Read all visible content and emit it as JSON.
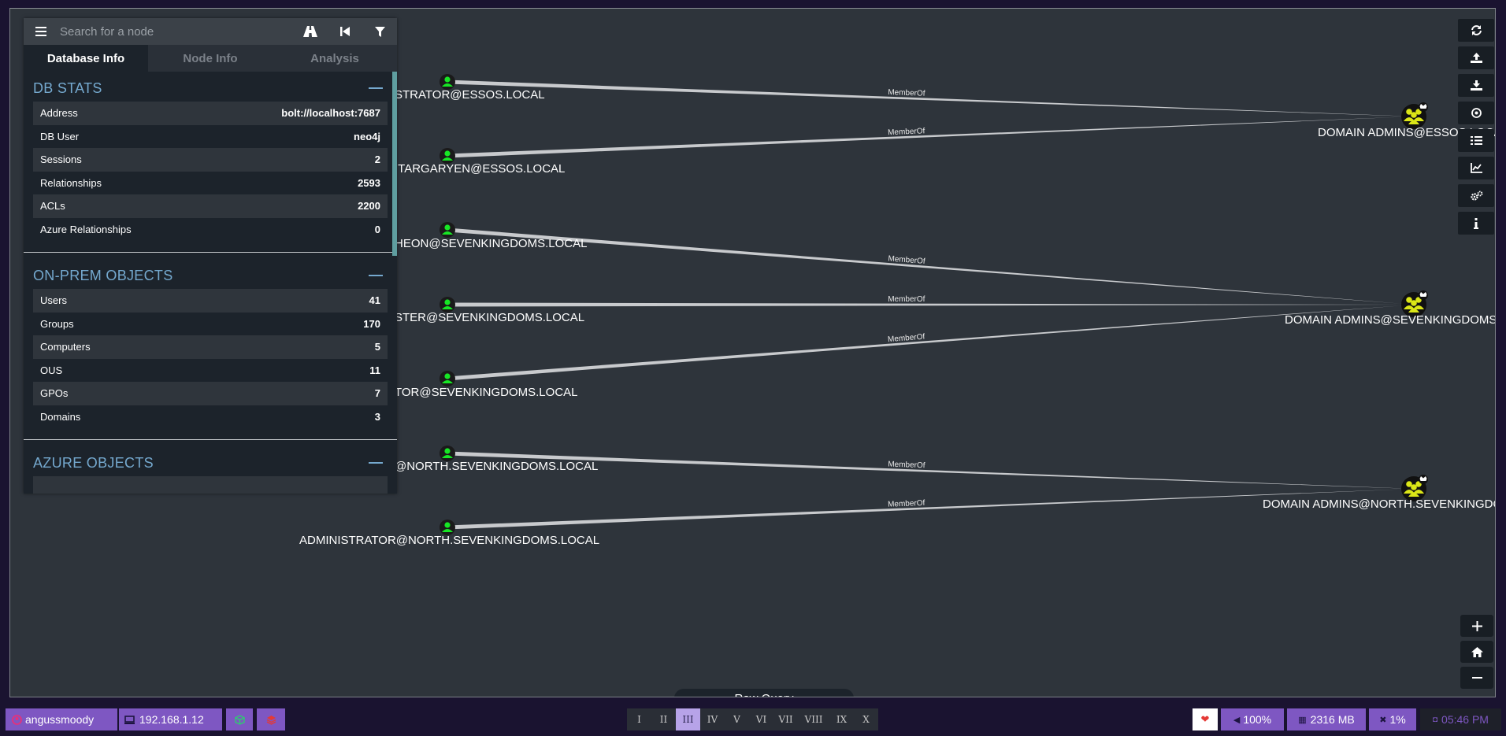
{
  "search": {
    "placeholder": "Search for a node"
  },
  "tabs": [
    {
      "label": "Database Info",
      "active": true
    },
    {
      "label": "Node Info",
      "active": false
    },
    {
      "label": "Analysis",
      "active": false
    }
  ],
  "db_stats": {
    "title": "DB STATS",
    "rows": [
      {
        "label": "Address",
        "value": "bolt://localhost:7687"
      },
      {
        "label": "DB User",
        "value": "neo4j"
      },
      {
        "label": "Sessions",
        "value": "2"
      },
      {
        "label": "Relationships",
        "value": "2593"
      },
      {
        "label": "ACLs",
        "value": "2200"
      },
      {
        "label": "Azure Relationships",
        "value": "0"
      }
    ]
  },
  "onprem": {
    "title": "ON-PREM OBJECTS",
    "rows": [
      {
        "label": "Users",
        "value": "41"
      },
      {
        "label": "Groups",
        "value": "170"
      },
      {
        "label": "Computers",
        "value": "5"
      },
      {
        "label": "OUS",
        "value": "11"
      },
      {
        "label": "GPOs",
        "value": "7"
      },
      {
        "label": "Domains",
        "value": "3"
      }
    ]
  },
  "azure": {
    "title": "AZURE OBJECTS"
  },
  "graph": {
    "users": [
      {
        "label": "STRATOR@ESSOS.LOCAL"
      },
      {
        "label": ".TARGARYEN@ESSOS.LOCAL"
      },
      {
        "label": "HEON@SEVENKINGDOMS.LOCAL"
      },
      {
        "label": "STER@SEVENKINGDOMS.LOCAL"
      },
      {
        "label": "TOR@SEVENKINGDOMS.LOCAL"
      },
      {
        "label": "@NORTH.SEVENKINGDOMS.LOCAL"
      },
      {
        "label": "ADMINISTRATOR@NORTH.SEVENKINGDOMS.LOCAL"
      }
    ],
    "groups": [
      {
        "label": "DOMAIN ADMINS@ESSOS.LOCAL"
      },
      {
        "label": "DOMAIN ADMINS@SEVENKINGDOMS.LOCAL"
      },
      {
        "label": "DOMAIN ADMINS@NORTH.SEVENKINGDOMS.LOCAL"
      }
    ],
    "edges": [
      {
        "from": 0,
        "to": 0,
        "label": "MemberOf"
      },
      {
        "from": 1,
        "to": 0,
        "label": "MemberOf"
      },
      {
        "from": 2,
        "to": 1,
        "label": "MemberOf"
      },
      {
        "from": 3,
        "to": 1,
        "label": "MemberOf"
      },
      {
        "from": 4,
        "to": 1,
        "label": "MemberOf"
      },
      {
        "from": 5,
        "to": 2,
        "label": "MemberOf"
      },
      {
        "from": 6,
        "to": 2,
        "label": "MemberOf"
      }
    ]
  },
  "raw_query": {
    "label": "Raw Query"
  },
  "toolbar_icons": [
    "refresh-icon",
    "upload-icon",
    "download-icon",
    "eye-icon",
    "list-icon",
    "chart-icon",
    "settings-icon",
    "info-icon"
  ],
  "taskbar": {
    "user": "angussmoody",
    "ip": "192.168.1.12",
    "workspaces": [
      "I",
      "II",
      "III",
      "IV",
      "V",
      "VI",
      "VII",
      "VIII",
      "IX",
      "X"
    ],
    "active_workspace": "III",
    "volume": "100%",
    "memory": "2316 MB",
    "cpu": "1%",
    "time": "05:46 PM"
  },
  "colors": {
    "canvas": "#2e343b",
    "panel": "#1c232b",
    "section_title": "#75a9cf",
    "user_node": "#17e625",
    "group_node": "#dbe617",
    "taskbar_accent": "#7e57c2"
  }
}
